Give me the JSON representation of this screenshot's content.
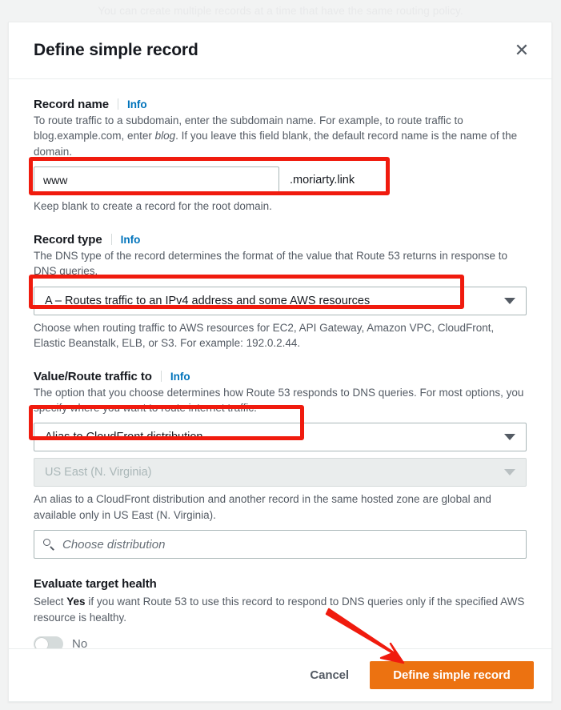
{
  "backdrop": {
    "text": "You can create multiple records at a time that have the same routing policy."
  },
  "modal": {
    "title": "Define simple record",
    "close_icon": "close-icon"
  },
  "fields": {
    "record_name": {
      "label": "Record name",
      "info": "Info",
      "description_1": "To route traffic to a subdomain, enter the subdomain name. For example, to route traffic to blog.example.com, enter ",
      "description_em": "blog",
      "description_2": ". If you leave this field blank, the default record name is the name of the domain.",
      "value": "www",
      "suffix": ".moriarty.link",
      "hint": "Keep blank to create a record for the root domain."
    },
    "record_type": {
      "label": "Record type",
      "info": "Info",
      "description": "The DNS type of the record determines the format of the value that Route 53 returns in response to DNS queries.",
      "value": "A – Routes traffic to an IPv4 address and some AWS resources",
      "hint": "Choose when routing traffic to AWS resources for EC2, API Gateway, Amazon VPC, CloudFront, Elastic Beanstalk, ELB, or S3. For example: 192.0.2.44."
    },
    "value_route": {
      "label": "Value/Route traffic to",
      "info": "Info",
      "description": "The option that you choose determines how Route 53 responds to DNS queries. For most options, you specify where you want to route internet traffic.",
      "value": "Alias to CloudFront distribution",
      "region_value": "US East (N. Virginia)",
      "region_hint": "An alias to a CloudFront distribution and another record in the same hosted zone are global and available only in US East (N. Virginia).",
      "distribution_placeholder": "Choose distribution",
      "search_icon": "search-icon"
    },
    "evaluate_health": {
      "label": "Evaluate target health",
      "description_1": "Select ",
      "description_bold": "Yes",
      "description_2": " if you want Route 53 to use this record to respond to DNS queries only if the specified AWS resource is healthy.",
      "toggle_state": "No"
    }
  },
  "footer": {
    "cancel_label": "Cancel",
    "submit_label": "Define simple record"
  },
  "colors": {
    "accent_orange": "#ec7211",
    "link_blue": "#0073bb",
    "annotation_red": "#f01b0e",
    "text_primary": "#16191f",
    "text_secondary": "#545b64"
  }
}
